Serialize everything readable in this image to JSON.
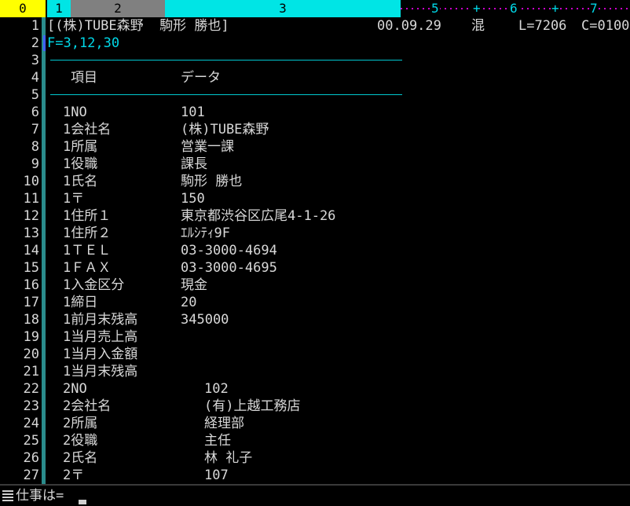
{
  "ruler": {
    "segments": [
      {
        "label": "0",
        "state": "sel"
      },
      {
        "label": "1",
        "state": "on"
      },
      {
        "label": "2",
        "state": "off"
      },
      {
        "label": "3",
        "state": "on"
      }
    ],
    "markers": [
      "5",
      "+",
      "6",
      "+",
      "7"
    ]
  },
  "lines": [
    "1",
    "2",
    "3",
    "4",
    "5",
    "6",
    "7",
    "8",
    "9",
    "10",
    "11",
    "12",
    "13",
    "14",
    "15",
    "16",
    "17",
    "18",
    "19",
    "20",
    "21",
    "22",
    "23",
    "24",
    "25",
    "26",
    "27"
  ],
  "header": {
    "record": "[(株)TUBE森野  駒形 勝也]",
    "date": "00.09.29",
    "mode": "混",
    "length": "L=7206",
    "column": "C=0100"
  },
  "fkey": "F=3,12,30",
  "table_header": {
    "item": "項目",
    "data": "データ"
  },
  "records": [
    {
      "label": "1NO",
      "value": "101",
      "indent": false
    },
    {
      "label": "1会社名",
      "value": "(株)TUBE森野",
      "indent": false
    },
    {
      "label": "1所属",
      "value": "営業一課",
      "indent": false
    },
    {
      "label": "1役職",
      "value": "課長",
      "indent": false
    },
    {
      "label": "1氏名",
      "value": "駒形 勝也",
      "indent": false
    },
    {
      "label": "1〒",
      "value": "150",
      "indent": false
    },
    {
      "label": "1住所１",
      "value": "東京都渋谷区広尾4-1-26",
      "indent": false
    },
    {
      "label": "1住所２",
      "value": "ｴﾙｼﾃｨ9F",
      "indent": false
    },
    {
      "label": "1ＴＥＬ",
      "value": "03-3000-4694",
      "indent": false
    },
    {
      "label": "1ＦＡＸ",
      "value": "03-3000-4695",
      "indent": false
    },
    {
      "label": "1入金区分",
      "value": "現金",
      "indent": false
    },
    {
      "label": "1締日",
      "value": "20",
      "indent": false
    },
    {
      "label": "1前月末残高",
      "value": "345000",
      "indent": false
    },
    {
      "label": "1当月売上高",
      "value": "",
      "indent": false
    },
    {
      "label": "1当月入金額",
      "value": "",
      "indent": false
    },
    {
      "label": "1当月末残高",
      "value": "",
      "indent": false
    },
    {
      "label": "2NO",
      "value": "102",
      "indent": true
    },
    {
      "label": "2会社名",
      "value": "(有)上越工務店",
      "indent": true
    },
    {
      "label": "2所属",
      "value": "経理部",
      "indent": true
    },
    {
      "label": "2役職",
      "value": "主任",
      "indent": true
    },
    {
      "label": "2氏名",
      "value": "林 礼子",
      "indent": true
    },
    {
      "label": "2〒",
      "value": "107",
      "indent": true
    }
  ],
  "status": {
    "prompt": "仕事は=",
    "value": ""
  },
  "colors": {
    "ruler_yellow": "#ffff00",
    "ruler_cyan": "#00e5e5",
    "ruler_gray": "#808080",
    "rule_line": "#00c8d0",
    "dots": "#cc00cc",
    "fkey": "#00d8e8"
  }
}
